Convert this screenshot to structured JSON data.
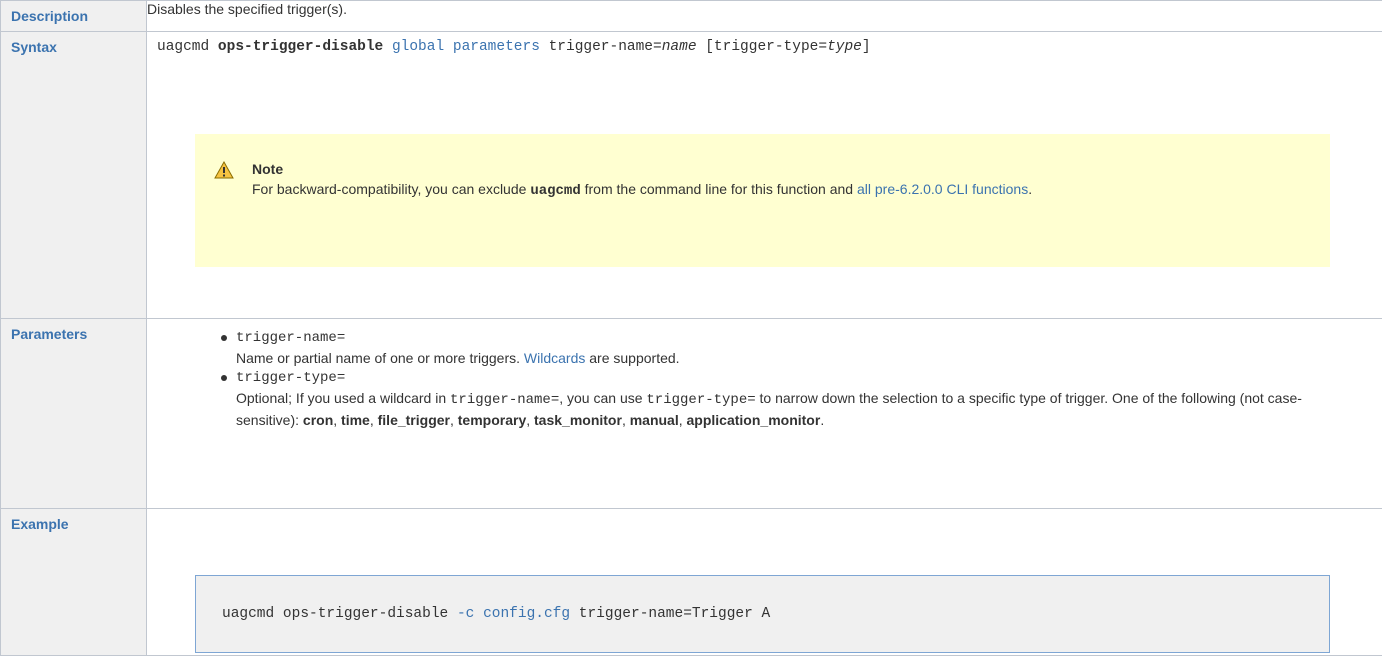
{
  "rows": {
    "description": {
      "header": "Description",
      "text": "Disables the specified trigger(s)."
    },
    "syntax": {
      "header": "Syntax",
      "cmd": "uagcmd",
      "op": "ops-trigger-disable",
      "global": "global",
      "parameters": "parameters",
      "arg1_key": "trigger-name=",
      "arg1_val": "name",
      "arg2_open": "[trigger-type=",
      "arg2_val": "type",
      "arg2_close": "]"
    },
    "note": {
      "title": "Note",
      "text_before": "For backward-compatibility, you can exclude",
      "code": "uagcmd",
      "text_middle": "from the command line for this function and",
      "link": "all pre-6.2.0.0 CLI functions",
      "text_after": "."
    },
    "parameters": {
      "header": "Parameters",
      "items": [
        {
          "name": "trigger-name=",
          "desc_before": "Name or partial name of one or more triggers.",
          "link": "Wildcards",
          "desc_after": "are supported."
        },
        {
          "name": "trigger-type=",
          "desc_1": "Optional; If you used a wildcard in",
          "code_1": "trigger-name=",
          "desc_2": ", you can use",
          "code_2": "trigger-type=",
          "desc_3": "to narrow down the selection to a specific type of trigger. One of the following (not case-sensitive):",
          "values": [
            "cron",
            "time",
            "file_trigger",
            "temporary",
            "task_monitor",
            "manual",
            "application_monitor"
          ]
        }
      ]
    },
    "example": {
      "header": "Example",
      "code_before": "uagcmd ops-trigger-disable",
      "flag": "-c",
      "file": "config.cfg",
      "code_after": "trigger-name=Trigger A"
    }
  },
  "colors": {
    "link": "#3b73af",
    "header_bg": "#f0f0f0",
    "note_bg": "#ffffd1",
    "border": "#c1c7d0"
  },
  "icons": {
    "note": "warning-triangle-icon"
  }
}
